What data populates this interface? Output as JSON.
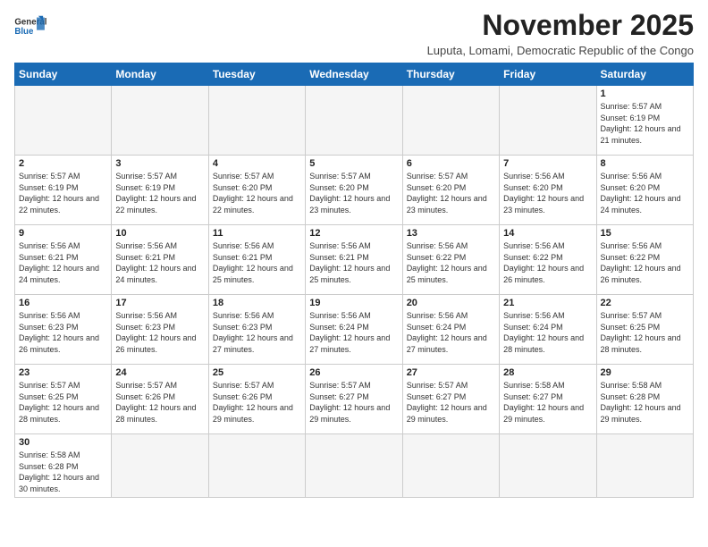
{
  "header": {
    "logo_general": "General",
    "logo_blue": "Blue",
    "month_title": "November 2025",
    "subtitle": "Luputa, Lomami, Democratic Republic of the Congo"
  },
  "weekdays": [
    "Sunday",
    "Monday",
    "Tuesday",
    "Wednesday",
    "Thursday",
    "Friday",
    "Saturday"
  ],
  "weeks": [
    [
      null,
      null,
      null,
      null,
      null,
      null,
      {
        "day": "1",
        "sunrise": "5:57 AM",
        "sunset": "6:19 PM",
        "daylight": "12 hours and 21 minutes."
      }
    ],
    [
      {
        "day": "2",
        "sunrise": "5:57 AM",
        "sunset": "6:19 PM",
        "daylight": "12 hours and 22 minutes."
      },
      {
        "day": "3",
        "sunrise": "5:57 AM",
        "sunset": "6:19 PM",
        "daylight": "12 hours and 22 minutes."
      },
      {
        "day": "4",
        "sunrise": "5:57 AM",
        "sunset": "6:20 PM",
        "daylight": "12 hours and 22 minutes."
      },
      {
        "day": "5",
        "sunrise": "5:57 AM",
        "sunset": "6:20 PM",
        "daylight": "12 hours and 23 minutes."
      },
      {
        "day": "6",
        "sunrise": "5:57 AM",
        "sunset": "6:20 PM",
        "daylight": "12 hours and 23 minutes."
      },
      {
        "day": "7",
        "sunrise": "5:56 AM",
        "sunset": "6:20 PM",
        "daylight": "12 hours and 23 minutes."
      },
      {
        "day": "8",
        "sunrise": "5:56 AM",
        "sunset": "6:20 PM",
        "daylight": "12 hours and 24 minutes."
      }
    ],
    [
      {
        "day": "9",
        "sunrise": "5:56 AM",
        "sunset": "6:21 PM",
        "daylight": "12 hours and 24 minutes."
      },
      {
        "day": "10",
        "sunrise": "5:56 AM",
        "sunset": "6:21 PM",
        "daylight": "12 hours and 24 minutes."
      },
      {
        "day": "11",
        "sunrise": "5:56 AM",
        "sunset": "6:21 PM",
        "daylight": "12 hours and 25 minutes."
      },
      {
        "day": "12",
        "sunrise": "5:56 AM",
        "sunset": "6:21 PM",
        "daylight": "12 hours and 25 minutes."
      },
      {
        "day": "13",
        "sunrise": "5:56 AM",
        "sunset": "6:22 PM",
        "daylight": "12 hours and 25 minutes."
      },
      {
        "day": "14",
        "sunrise": "5:56 AM",
        "sunset": "6:22 PM",
        "daylight": "12 hours and 26 minutes."
      },
      {
        "day": "15",
        "sunrise": "5:56 AM",
        "sunset": "6:22 PM",
        "daylight": "12 hours and 26 minutes."
      }
    ],
    [
      {
        "day": "16",
        "sunrise": "5:56 AM",
        "sunset": "6:23 PM",
        "daylight": "12 hours and 26 minutes."
      },
      {
        "day": "17",
        "sunrise": "5:56 AM",
        "sunset": "6:23 PM",
        "daylight": "12 hours and 26 minutes."
      },
      {
        "day": "18",
        "sunrise": "5:56 AM",
        "sunset": "6:23 PM",
        "daylight": "12 hours and 27 minutes."
      },
      {
        "day": "19",
        "sunrise": "5:56 AM",
        "sunset": "6:24 PM",
        "daylight": "12 hours and 27 minutes."
      },
      {
        "day": "20",
        "sunrise": "5:56 AM",
        "sunset": "6:24 PM",
        "daylight": "12 hours and 27 minutes."
      },
      {
        "day": "21",
        "sunrise": "5:56 AM",
        "sunset": "6:24 PM",
        "daylight": "12 hours and 28 minutes."
      },
      {
        "day": "22",
        "sunrise": "5:57 AM",
        "sunset": "6:25 PM",
        "daylight": "12 hours and 28 minutes."
      }
    ],
    [
      {
        "day": "23",
        "sunrise": "5:57 AM",
        "sunset": "6:25 PM",
        "daylight": "12 hours and 28 minutes."
      },
      {
        "day": "24",
        "sunrise": "5:57 AM",
        "sunset": "6:26 PM",
        "daylight": "12 hours and 28 minutes."
      },
      {
        "day": "25",
        "sunrise": "5:57 AM",
        "sunset": "6:26 PM",
        "daylight": "12 hours and 29 minutes."
      },
      {
        "day": "26",
        "sunrise": "5:57 AM",
        "sunset": "6:27 PM",
        "daylight": "12 hours and 29 minutes."
      },
      {
        "day": "27",
        "sunrise": "5:57 AM",
        "sunset": "6:27 PM",
        "daylight": "12 hours and 29 minutes."
      },
      {
        "day": "28",
        "sunrise": "5:58 AM",
        "sunset": "6:27 PM",
        "daylight": "12 hours and 29 minutes."
      },
      {
        "day": "29",
        "sunrise": "5:58 AM",
        "sunset": "6:28 PM",
        "daylight": "12 hours and 29 minutes."
      }
    ],
    [
      {
        "day": "30",
        "sunrise": "5:58 AM",
        "sunset": "6:28 PM",
        "daylight": "12 hours and 30 minutes."
      },
      null,
      null,
      null,
      null,
      null,
      null
    ]
  ]
}
